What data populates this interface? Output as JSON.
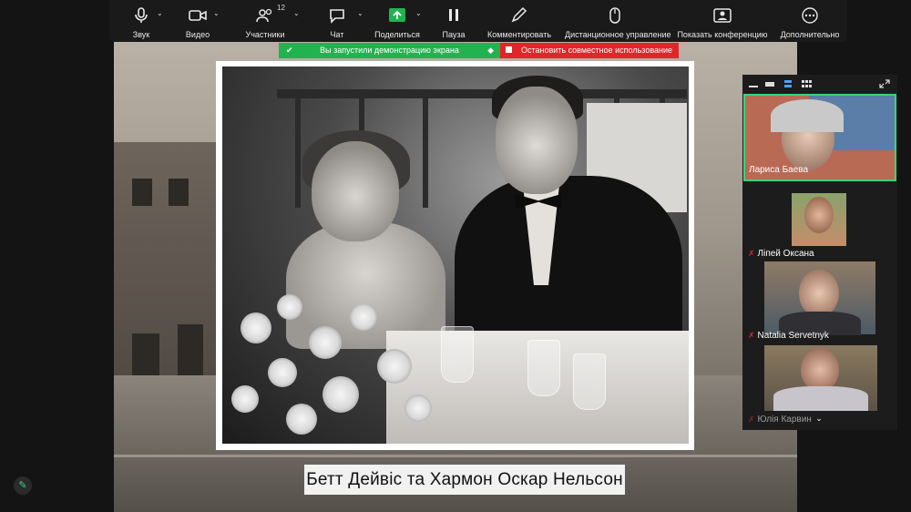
{
  "toolbar": {
    "items": [
      {
        "label": "Звук",
        "icon": "microphone-icon"
      },
      {
        "label": "Видео",
        "icon": "camera-icon"
      },
      {
        "label": "Участники",
        "icon": "participants-icon",
        "count": "12"
      },
      {
        "label": "Чат",
        "icon": "chat-icon"
      },
      {
        "label": "Поделиться",
        "icon": "share-screen-icon"
      },
      {
        "label": "Пауза",
        "icon": "pause-icon"
      },
      {
        "label": "Комментировать",
        "icon": "annotate-pen-icon"
      },
      {
        "label": "Дистанционное управление",
        "icon": "mouse-icon"
      },
      {
        "label": "Показать конференцию",
        "icon": "show-meeting-icon"
      },
      {
        "label": "Дополнительно",
        "icon": "more-icon"
      }
    ]
  },
  "share_status": {
    "sharing_text": "Вы запустили демонстрацию экрана",
    "stop_text": "Остановить совместное использование"
  },
  "slide": {
    "caption": "Бетт Дейвіс та Хармон Оскар Нельсон"
  },
  "gallery": {
    "participants": [
      {
        "name": "Лариса Баева",
        "muted": false
      },
      {
        "name": "Лiпей Оксана",
        "muted": true
      },
      {
        "name": "Natalia Servetnyk",
        "muted": true
      },
      {
        "name": "Юлія Карвин",
        "muted": true
      }
    ]
  },
  "colors": {
    "toolbar_bg": "#1a1a1a",
    "share_green": "#21b350",
    "stop_red": "#e0262a",
    "active_speaker_border": "#3ad47a"
  }
}
